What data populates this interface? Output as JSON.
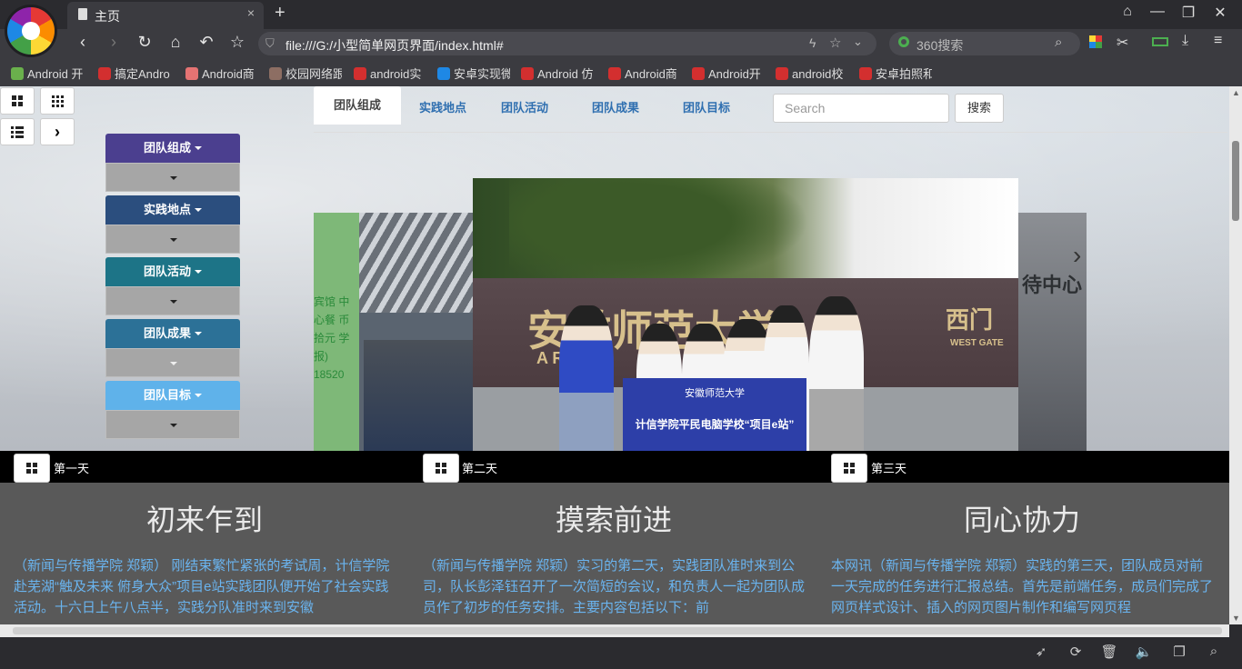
{
  "browser": {
    "tab_title": "主页",
    "tab_close": "×",
    "new_tab": "+",
    "url": "file:///G:/小型简单网页界面/index.html#",
    "search_placeholder": "360搜索",
    "bookmarks": [
      {
        "label": "Android 开",
        "color": "#6ab04c"
      },
      {
        "label": "搞定Andro",
        "color": "#d32f2f"
      },
      {
        "label": "Android商",
        "color": "#e57373"
      },
      {
        "label": "校园网络跟",
        "color": "#8d6e63"
      },
      {
        "label": "android实",
        "color": "#d32f2f"
      },
      {
        "label": "安卓实现微",
        "color": "#1e88e5"
      },
      {
        "label": "Android 仿",
        "color": "#d32f2f"
      },
      {
        "label": "Android商",
        "color": "#d32f2f"
      },
      {
        "label": "Android开",
        "color": "#d32f2f"
      },
      {
        "label": "android校",
        "color": "#d32f2f"
      },
      {
        "label": "安卓拍照和",
        "color": "#d32f2f"
      }
    ]
  },
  "sidebar": {
    "items": [
      {
        "label": "团队组成",
        "color": "#4b3f8f"
      },
      {
        "label": "实践地点",
        "color": "#2b4e7e"
      },
      {
        "label": "团队活动",
        "color": "#1d7487"
      },
      {
        "label": "团队成果",
        "color": "#2c7197"
      },
      {
        "label": "团队目标",
        "color": "#5fb2ea"
      }
    ]
  },
  "topnav": {
    "items": [
      "团队组成",
      "实践地点",
      "团队活动",
      "团队成果",
      "团队目标"
    ],
    "search_placeholder": "Search",
    "search_button": "搜索"
  },
  "carousel": {
    "left_photo_text": "宾馆 中心餐 币拾元 学报) 18520",
    "right_photo_text": "待中心",
    "main_cn": "安徽师范大学",
    "main_gate": "西门",
    "main_gate_en": "WEST GATE",
    "main_en": "A           RSITY",
    "banner_top": "安徽师范大学",
    "banner_text": "计信学院平民电脑学校“项目e站”"
  },
  "days": [
    {
      "label": "第一天",
      "heading": "初来乍到",
      "body": "（新闻与传播学院 郑颖） 刚结束繁忙紧张的考试周，计信学院赴芜湖“触及未来 俯身大众”项目e站实践团队便开始了社会实践活动。十六日上午八点半，实践分队准时来到安徽"
    },
    {
      "label": "第二天",
      "heading": "摸索前进",
      "body": "（新闻与传播学院 郑颖）实习的第二天，实践团队准时来到公司，队长彭泽钰召开了一次简短的会议，和负责人一起为团队成员作了初步的任务安排。主要内容包括以下：前"
    },
    {
      "label": "第三天",
      "heading": "同心协力",
      "body": "本网讯（新闻与传播学院 郑颖）实践的第三天，团队成员对前一天完成的任务进行汇报总结。首先是前端任务，成员们完成了网页样式设计、插入的网页图片制作和编写网页程"
    }
  ]
}
